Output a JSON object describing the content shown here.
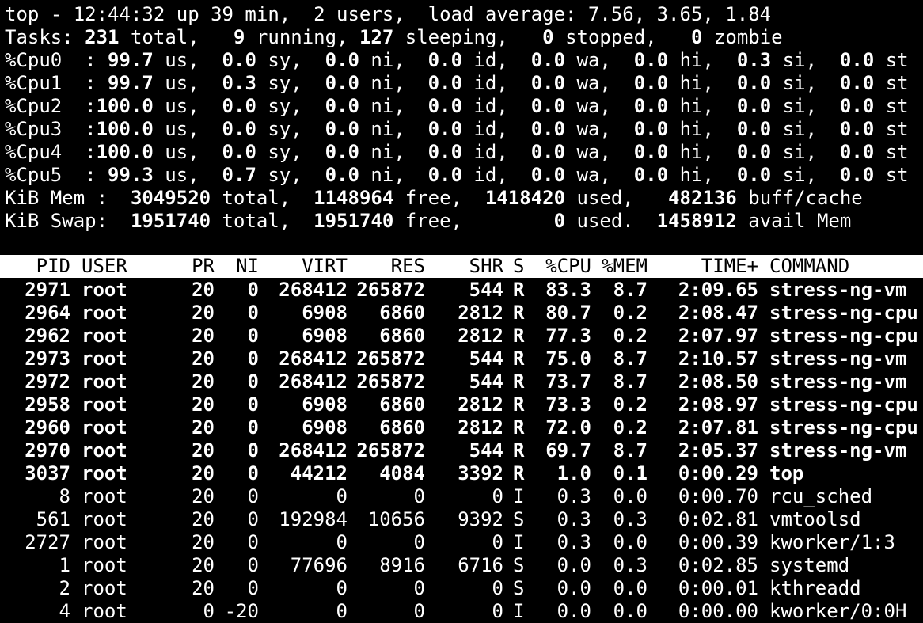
{
  "summary": {
    "uptime_line": [
      {
        "t": "top - 12:44:32 up 39 min,  2 users,  load average: 7.56, 3.65, 1.84",
        "b": false
      }
    ],
    "tasks_line": [
      {
        "t": "Tasks: ",
        "b": false
      },
      {
        "t": "231",
        "b": true
      },
      {
        "t": " total,   ",
        "b": false
      },
      {
        "t": "9",
        "b": true
      },
      {
        "t": " running, ",
        "b": false
      },
      {
        "t": "127",
        "b": true
      },
      {
        "t": " sleeping,   ",
        "b": false
      },
      {
        "t": "0",
        "b": true
      },
      {
        "t": " stopped,   ",
        "b": false
      },
      {
        "t": "0",
        "b": true
      },
      {
        "t": " zombie",
        "b": false
      }
    ],
    "cpu_lines": [
      [
        {
          "t": "%Cpu0  : ",
          "b": false
        },
        {
          "t": "99.7",
          "b": true
        },
        {
          "t": " us,  ",
          "b": false
        },
        {
          "t": "0.0",
          "b": true
        },
        {
          "t": " sy,  ",
          "b": false
        },
        {
          "t": "0.0",
          "b": true
        },
        {
          "t": " ni,  ",
          "b": false
        },
        {
          "t": "0.0",
          "b": true
        },
        {
          "t": " id,  ",
          "b": false
        },
        {
          "t": "0.0",
          "b": true
        },
        {
          "t": " wa,  ",
          "b": false
        },
        {
          "t": "0.0",
          "b": true
        },
        {
          "t": " hi,  ",
          "b": false
        },
        {
          "t": "0.3",
          "b": true
        },
        {
          "t": " si,  ",
          "b": false
        },
        {
          "t": "0.0",
          "b": true
        },
        {
          "t": " st",
          "b": false
        }
      ],
      [
        {
          "t": "%Cpu1  : ",
          "b": false
        },
        {
          "t": "99.7",
          "b": true
        },
        {
          "t": " us,  ",
          "b": false
        },
        {
          "t": "0.3",
          "b": true
        },
        {
          "t": " sy,  ",
          "b": false
        },
        {
          "t": "0.0",
          "b": true
        },
        {
          "t": " ni,  ",
          "b": false
        },
        {
          "t": "0.0",
          "b": true
        },
        {
          "t": " id,  ",
          "b": false
        },
        {
          "t": "0.0",
          "b": true
        },
        {
          "t": " wa,  ",
          "b": false
        },
        {
          "t": "0.0",
          "b": true
        },
        {
          "t": " hi,  ",
          "b": false
        },
        {
          "t": "0.0",
          "b": true
        },
        {
          "t": " si,  ",
          "b": false
        },
        {
          "t": "0.0",
          "b": true
        },
        {
          "t": " st",
          "b": false
        }
      ],
      [
        {
          "t": "%Cpu2  :",
          "b": false
        },
        {
          "t": "100.0",
          "b": true
        },
        {
          "t": " us,  ",
          "b": false
        },
        {
          "t": "0.0",
          "b": true
        },
        {
          "t": " sy,  ",
          "b": false
        },
        {
          "t": "0.0",
          "b": true
        },
        {
          "t": " ni,  ",
          "b": false
        },
        {
          "t": "0.0",
          "b": true
        },
        {
          "t": " id,  ",
          "b": false
        },
        {
          "t": "0.0",
          "b": true
        },
        {
          "t": " wa,  ",
          "b": false
        },
        {
          "t": "0.0",
          "b": true
        },
        {
          "t": " hi,  ",
          "b": false
        },
        {
          "t": "0.0",
          "b": true
        },
        {
          "t": " si,  ",
          "b": false
        },
        {
          "t": "0.0",
          "b": true
        },
        {
          "t": " st",
          "b": false
        }
      ],
      [
        {
          "t": "%Cpu3  :",
          "b": false
        },
        {
          "t": "100.0",
          "b": true
        },
        {
          "t": " us,  ",
          "b": false
        },
        {
          "t": "0.0",
          "b": true
        },
        {
          "t": " sy,  ",
          "b": false
        },
        {
          "t": "0.0",
          "b": true
        },
        {
          "t": " ni,  ",
          "b": false
        },
        {
          "t": "0.0",
          "b": true
        },
        {
          "t": " id,  ",
          "b": false
        },
        {
          "t": "0.0",
          "b": true
        },
        {
          "t": " wa,  ",
          "b": false
        },
        {
          "t": "0.0",
          "b": true
        },
        {
          "t": " hi,  ",
          "b": false
        },
        {
          "t": "0.0",
          "b": true
        },
        {
          "t": " si,  ",
          "b": false
        },
        {
          "t": "0.0",
          "b": true
        },
        {
          "t": " st",
          "b": false
        }
      ],
      [
        {
          "t": "%Cpu4  :",
          "b": false
        },
        {
          "t": "100.0",
          "b": true
        },
        {
          "t": " us,  ",
          "b": false
        },
        {
          "t": "0.0",
          "b": true
        },
        {
          "t": " sy,  ",
          "b": false
        },
        {
          "t": "0.0",
          "b": true
        },
        {
          "t": " ni,  ",
          "b": false
        },
        {
          "t": "0.0",
          "b": true
        },
        {
          "t": " id,  ",
          "b": false
        },
        {
          "t": "0.0",
          "b": true
        },
        {
          "t": " wa,  ",
          "b": false
        },
        {
          "t": "0.0",
          "b": true
        },
        {
          "t": " hi,  ",
          "b": false
        },
        {
          "t": "0.0",
          "b": true
        },
        {
          "t": " si,  ",
          "b": false
        },
        {
          "t": "0.0",
          "b": true
        },
        {
          "t": " st",
          "b": false
        }
      ],
      [
        {
          "t": "%Cpu5  : ",
          "b": false
        },
        {
          "t": "99.3",
          "b": true
        },
        {
          "t": " us,  ",
          "b": false
        },
        {
          "t": "0.7",
          "b": true
        },
        {
          "t": " sy,  ",
          "b": false
        },
        {
          "t": "0.0",
          "b": true
        },
        {
          "t": " ni,  ",
          "b": false
        },
        {
          "t": "0.0",
          "b": true
        },
        {
          "t": " id,  ",
          "b": false
        },
        {
          "t": "0.0",
          "b": true
        },
        {
          "t": " wa,  ",
          "b": false
        },
        {
          "t": "0.0",
          "b": true
        },
        {
          "t": " hi,  ",
          "b": false
        },
        {
          "t": "0.0",
          "b": true
        },
        {
          "t": " si,  ",
          "b": false
        },
        {
          "t": "0.0",
          "b": true
        },
        {
          "t": " st",
          "b": false
        }
      ]
    ],
    "mem_line": [
      {
        "t": "KiB Mem :  ",
        "b": false
      },
      {
        "t": "3049520",
        "b": true
      },
      {
        "t": " total,  ",
        "b": false
      },
      {
        "t": "1148964",
        "b": true
      },
      {
        "t": " free,  ",
        "b": false
      },
      {
        "t": "1418420",
        "b": true
      },
      {
        "t": " used,   ",
        "b": false
      },
      {
        "t": "482136",
        "b": true
      },
      {
        "t": " buff/cache",
        "b": false
      }
    ],
    "swap_line": [
      {
        "t": "KiB Swap:  ",
        "b": false
      },
      {
        "t": "1951740",
        "b": true
      },
      {
        "t": " total,  ",
        "b": false
      },
      {
        "t": "1951740",
        "b": true
      },
      {
        "t": " free,        ",
        "b": false
      },
      {
        "t": "0",
        "b": true
      },
      {
        "t": " used.  ",
        "b": false
      },
      {
        "t": "1458912",
        "b": true
      },
      {
        "t": " avail Mem",
        "b": false
      }
    ]
  },
  "columns": [
    "PID",
    "USER",
    "PR",
    "NI",
    "VIRT",
    "RES",
    "SHR",
    "S",
    "%CPU",
    "%MEM",
    "TIME+",
    "COMMAND"
  ],
  "processes": [
    {
      "pid": "2971",
      "user": "root",
      "pr": "20",
      "ni": "0",
      "virt": "268412",
      "res": "265872",
      "shr": "544",
      "s": "R",
      "cpu": "83.3",
      "mem": "8.7",
      "time": "2:09.65",
      "command": "stress-ng-vm",
      "running": true
    },
    {
      "pid": "2964",
      "user": "root",
      "pr": "20",
      "ni": "0",
      "virt": "6908",
      "res": "6860",
      "shr": "2812",
      "s": "R",
      "cpu": "80.7",
      "mem": "0.2",
      "time": "2:08.47",
      "command": "stress-ng-cpu",
      "running": true
    },
    {
      "pid": "2962",
      "user": "root",
      "pr": "20",
      "ni": "0",
      "virt": "6908",
      "res": "6860",
      "shr": "2812",
      "s": "R",
      "cpu": "77.3",
      "mem": "0.2",
      "time": "2:07.97",
      "command": "stress-ng-cpu",
      "running": true
    },
    {
      "pid": "2973",
      "user": "root",
      "pr": "20",
      "ni": "0",
      "virt": "268412",
      "res": "265872",
      "shr": "544",
      "s": "R",
      "cpu": "75.0",
      "mem": "8.7",
      "time": "2:10.57",
      "command": "stress-ng-vm",
      "running": true
    },
    {
      "pid": "2972",
      "user": "root",
      "pr": "20",
      "ni": "0",
      "virt": "268412",
      "res": "265872",
      "shr": "544",
      "s": "R",
      "cpu": "73.7",
      "mem": "8.7",
      "time": "2:08.50",
      "command": "stress-ng-vm",
      "running": true
    },
    {
      "pid": "2958",
      "user": "root",
      "pr": "20",
      "ni": "0",
      "virt": "6908",
      "res": "6860",
      "shr": "2812",
      "s": "R",
      "cpu": "73.3",
      "mem": "0.2",
      "time": "2:08.97",
      "command": "stress-ng-cpu",
      "running": true
    },
    {
      "pid": "2960",
      "user": "root",
      "pr": "20",
      "ni": "0",
      "virt": "6908",
      "res": "6860",
      "shr": "2812",
      "s": "R",
      "cpu": "72.0",
      "mem": "0.2",
      "time": "2:07.81",
      "command": "stress-ng-cpu",
      "running": true
    },
    {
      "pid": "2970",
      "user": "root",
      "pr": "20",
      "ni": "0",
      "virt": "268412",
      "res": "265872",
      "shr": "544",
      "s": "R",
      "cpu": "69.7",
      "mem": "8.7",
      "time": "2:05.37",
      "command": "stress-ng-vm",
      "running": true
    },
    {
      "pid": "3037",
      "user": "root",
      "pr": "20",
      "ni": "0",
      "virt": "44212",
      "res": "4084",
      "shr": "3392",
      "s": "R",
      "cpu": "1.0",
      "mem": "0.1",
      "time": "0:00.29",
      "command": "top",
      "running": true
    },
    {
      "pid": "8",
      "user": "root",
      "pr": "20",
      "ni": "0",
      "virt": "0",
      "res": "0",
      "shr": "0",
      "s": "I",
      "cpu": "0.3",
      "mem": "0.0",
      "time": "0:00.70",
      "command": "rcu_sched",
      "running": false
    },
    {
      "pid": "561",
      "user": "root",
      "pr": "20",
      "ni": "0",
      "virt": "192984",
      "res": "10656",
      "shr": "9392",
      "s": "S",
      "cpu": "0.3",
      "mem": "0.3",
      "time": "0:02.81",
      "command": "vmtoolsd",
      "running": false
    },
    {
      "pid": "2727",
      "user": "root",
      "pr": "20",
      "ni": "0",
      "virt": "0",
      "res": "0",
      "shr": "0",
      "s": "I",
      "cpu": "0.3",
      "mem": "0.0",
      "time": "0:00.39",
      "command": "kworker/1:3",
      "running": false
    },
    {
      "pid": "1",
      "user": "root",
      "pr": "20",
      "ni": "0",
      "virt": "77696",
      "res": "8916",
      "shr": "6716",
      "s": "S",
      "cpu": "0.0",
      "mem": "0.3",
      "time": "0:02.85",
      "command": "systemd",
      "running": false
    },
    {
      "pid": "2",
      "user": "root",
      "pr": "20",
      "ni": "0",
      "virt": "0",
      "res": "0",
      "shr": "0",
      "s": "S",
      "cpu": "0.0",
      "mem": "0.0",
      "time": "0:00.01",
      "command": "kthreadd",
      "running": false
    },
    {
      "pid": "4",
      "user": "root",
      "pr": "0",
      "ni": "-20",
      "virt": "0",
      "res": "0",
      "shr": "0",
      "s": "I",
      "cpu": "0.0",
      "mem": "0.0",
      "time": "0:00.00",
      "command": "kworker/0:0H",
      "running": false
    }
  ]
}
